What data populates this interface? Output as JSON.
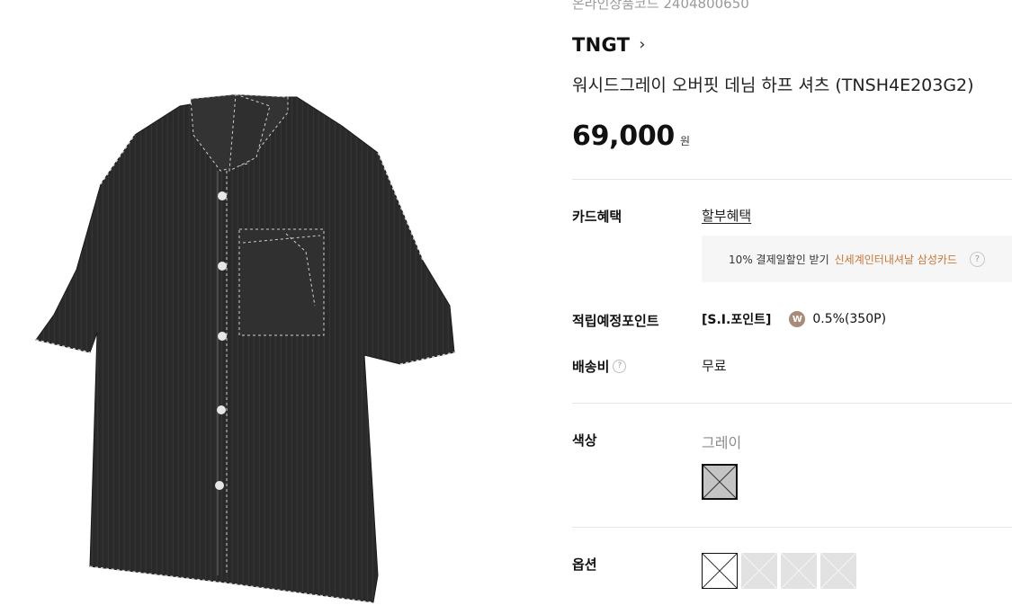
{
  "product": {
    "code_text": "온라인상품코드 2404800650",
    "brand": "TNGT",
    "brand_arrow_icon": "chevron-right-icon",
    "name": "워시드그레이 오버핏 데님 하프 셔츠 (TNSH4E203G2)",
    "price": "69,000",
    "price_unit": "원",
    "image_icon": "denim-shirt-image"
  },
  "card": {
    "label": "카드혜택",
    "link": "할부혜택",
    "benefit_prefix": "10% 결제일할인 받기",
    "benefit_highlight": "신세계인터내셔날 삼성카드",
    "help_glyph": "?"
  },
  "points": {
    "label": "적립예정포인트",
    "tag": "[S.I.포인트]",
    "coin_glyph": "W",
    "value": "0.5%(350P)"
  },
  "shipping": {
    "label": "배송비",
    "help_glyph": "?",
    "value": "무료"
  },
  "color": {
    "label": "색상",
    "value": "그레이",
    "swatch_color": "#c4c4c4"
  },
  "option": {
    "label": "옵션",
    "swatch_count_note": ""
  },
  "colors": {
    "highlight": "#c8773a",
    "divider": "#e6e6e6",
    "box_bg": "#f6f6f6",
    "coin": "#a98c78"
  }
}
